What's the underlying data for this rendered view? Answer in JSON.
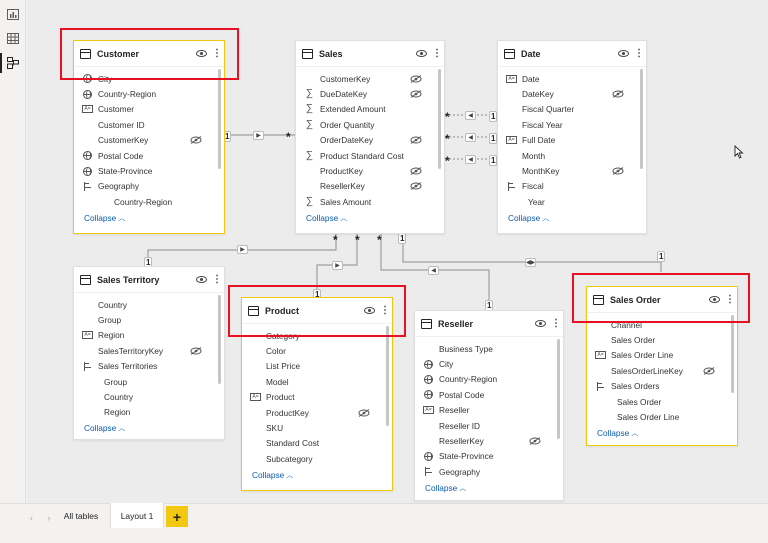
{
  "left_nav": [
    {
      "name": "report-view-icon"
    },
    {
      "name": "data-view-icon"
    },
    {
      "name": "model-view-icon",
      "active": true
    }
  ],
  "tables": {
    "customer": {
      "title": "Customer",
      "collapse": "Collapse",
      "fields": [
        {
          "label": "City",
          "icon": "globe",
          "hidden": false
        },
        {
          "label": "Country-Region",
          "icon": "globe",
          "hidden": false
        },
        {
          "label": "Customer",
          "icon": "abc",
          "hidden": false
        },
        {
          "label": "Customer ID",
          "icon": "",
          "hidden": false
        },
        {
          "label": "CustomerKey",
          "icon": "",
          "hidden": true
        },
        {
          "label": "Postal Code",
          "icon": "globe",
          "hidden": false
        },
        {
          "label": "State-Province",
          "icon": "globe",
          "hidden": false
        },
        {
          "label": "Geography",
          "icon": "hierarchy",
          "hidden": false
        },
        {
          "label": "Country-Region",
          "icon": "",
          "hidden": false,
          "indent": 2
        }
      ]
    },
    "sales": {
      "title": "Sales",
      "collapse": "Collapse",
      "fields": [
        {
          "label": "CustomerKey",
          "icon": "",
          "hidden": true
        },
        {
          "label": "DueDateKey",
          "icon": "sigma",
          "hidden": true
        },
        {
          "label": "Extended Amount",
          "icon": "sigma",
          "hidden": false
        },
        {
          "label": "Order Quantity",
          "icon": "sigma",
          "hidden": false
        },
        {
          "label": "OrderDateKey",
          "icon": "",
          "hidden": true
        },
        {
          "label": "Product Standard Cost",
          "icon": "sigma",
          "hidden": false
        },
        {
          "label": "ProductKey",
          "icon": "",
          "hidden": true
        },
        {
          "label": "ResellerKey",
          "icon": "",
          "hidden": true
        },
        {
          "label": "Sales Amount",
          "icon": "sigma",
          "hidden": false
        }
      ]
    },
    "date": {
      "title": "Date",
      "collapse": "Collapse",
      "fields": [
        {
          "label": "Date",
          "icon": "abc",
          "hidden": false
        },
        {
          "label": "DateKey",
          "icon": "",
          "hidden": true
        },
        {
          "label": "Fiscal Quarter",
          "icon": "",
          "hidden": false
        },
        {
          "label": "Fiscal Year",
          "icon": "",
          "hidden": false
        },
        {
          "label": "Full Date",
          "icon": "abc",
          "hidden": false
        },
        {
          "label": "Month",
          "icon": "",
          "hidden": false
        },
        {
          "label": "MonthKey",
          "icon": "",
          "hidden": true
        },
        {
          "label": "Fiscal",
          "icon": "hierarchy",
          "hidden": false
        },
        {
          "label": "Year",
          "icon": "",
          "hidden": false,
          "indent": 1
        }
      ]
    },
    "sales_territory": {
      "title": "Sales Territory",
      "collapse": "Collapse",
      "fields": [
        {
          "label": "Country",
          "icon": "",
          "hidden": false
        },
        {
          "label": "Group",
          "icon": "",
          "hidden": false
        },
        {
          "label": "Region",
          "icon": "abc",
          "hidden": false
        },
        {
          "label": "SalesTerritoryKey",
          "icon": "",
          "hidden": true
        },
        {
          "label": "Sales Territories",
          "icon": "hierarchy",
          "hidden": false
        },
        {
          "label": "Group",
          "icon": "",
          "hidden": false,
          "indent": 1
        },
        {
          "label": "Country",
          "icon": "",
          "hidden": false,
          "indent": 1
        },
        {
          "label": "Region",
          "icon": "",
          "hidden": false,
          "indent": 1
        }
      ]
    },
    "product": {
      "title": "Product",
      "collapse": "Collapse",
      "fields": [
        {
          "label": "Category",
          "icon": "",
          "hidden": false
        },
        {
          "label": "Color",
          "icon": "",
          "hidden": false
        },
        {
          "label": "List Price",
          "icon": "",
          "hidden": false
        },
        {
          "label": "Model",
          "icon": "",
          "hidden": false
        },
        {
          "label": "Product",
          "icon": "abc",
          "hidden": false
        },
        {
          "label": "ProductKey",
          "icon": "",
          "hidden": true
        },
        {
          "label": "SKU",
          "icon": "",
          "hidden": false
        },
        {
          "label": "Standard Cost",
          "icon": "",
          "hidden": false
        },
        {
          "label": "Subcategory",
          "icon": "",
          "hidden": false
        }
      ]
    },
    "reseller": {
      "title": "Reseller",
      "collapse": "Collapse",
      "fields": [
        {
          "label": "Business Type",
          "icon": "",
          "hidden": false
        },
        {
          "label": "City",
          "icon": "globe",
          "hidden": false
        },
        {
          "label": "Country-Region",
          "icon": "globe",
          "hidden": false
        },
        {
          "label": "Postal Code",
          "icon": "globe",
          "hidden": false
        },
        {
          "label": "Reseller",
          "icon": "abc",
          "hidden": false
        },
        {
          "label": "Reseller ID",
          "icon": "",
          "hidden": false
        },
        {
          "label": "ResellerKey",
          "icon": "",
          "hidden": true
        },
        {
          "label": "State-Province",
          "icon": "globe",
          "hidden": false
        },
        {
          "label": "Geography",
          "icon": "hierarchy",
          "hidden": false
        }
      ]
    },
    "sales_order": {
      "title": "Sales Order",
      "collapse": "Collapse",
      "fields": [
        {
          "label": "Channel",
          "icon": "",
          "hidden": false
        },
        {
          "label": "Sales Order",
          "icon": "",
          "hidden": false
        },
        {
          "label": "Sales Order Line",
          "icon": "abc",
          "hidden": false
        },
        {
          "label": "SalesOrderLineKey",
          "icon": "",
          "hidden": true
        },
        {
          "label": "Sales Orders",
          "icon": "hierarchy",
          "hidden": false
        },
        {
          "label": "Sales Order",
          "icon": "",
          "hidden": false,
          "indent": 1
        },
        {
          "label": "Sales Order Line",
          "icon": "",
          "hidden": false,
          "indent": 1
        }
      ]
    }
  },
  "relationships": {
    "one": "1",
    "many": "*"
  },
  "tabs": {
    "all_tables": "All tables",
    "layout1": "Layout 1",
    "add": "+"
  },
  "colors": {
    "selected_border": "#f2c811",
    "highlight": "#e81123",
    "link": "#0b5cad"
  }
}
